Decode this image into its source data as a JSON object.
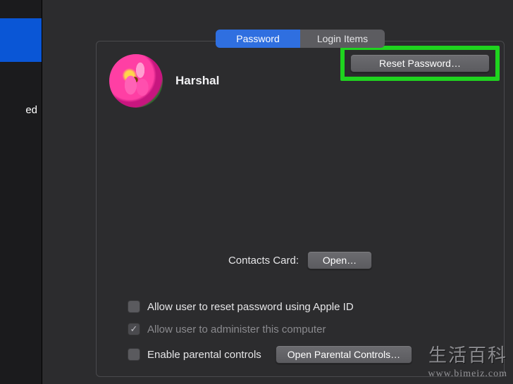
{
  "tabs": {
    "password": "Password",
    "login_items": "Login Items"
  },
  "sidebar": {
    "selected_label_fragment": "ed"
  },
  "user": {
    "name": "Harshal"
  },
  "buttons": {
    "reset_password": "Reset Password…",
    "open_contacts": "Open…",
    "open_parental": "Open Parental Controls…"
  },
  "labels": {
    "contacts_card": "Contacts Card:"
  },
  "checkboxes": {
    "allow_reset_apple_id": {
      "label": "Allow user to reset password using Apple ID",
      "checked": false,
      "enabled": true
    },
    "allow_admin": {
      "label": "Allow user to administer this computer",
      "checked": true,
      "enabled": false
    },
    "enable_parental": {
      "label": "Enable parental controls",
      "checked": false,
      "enabled": true
    }
  },
  "watermark": {
    "line1": "生活百科",
    "line2": "www.bimeiz.com"
  }
}
